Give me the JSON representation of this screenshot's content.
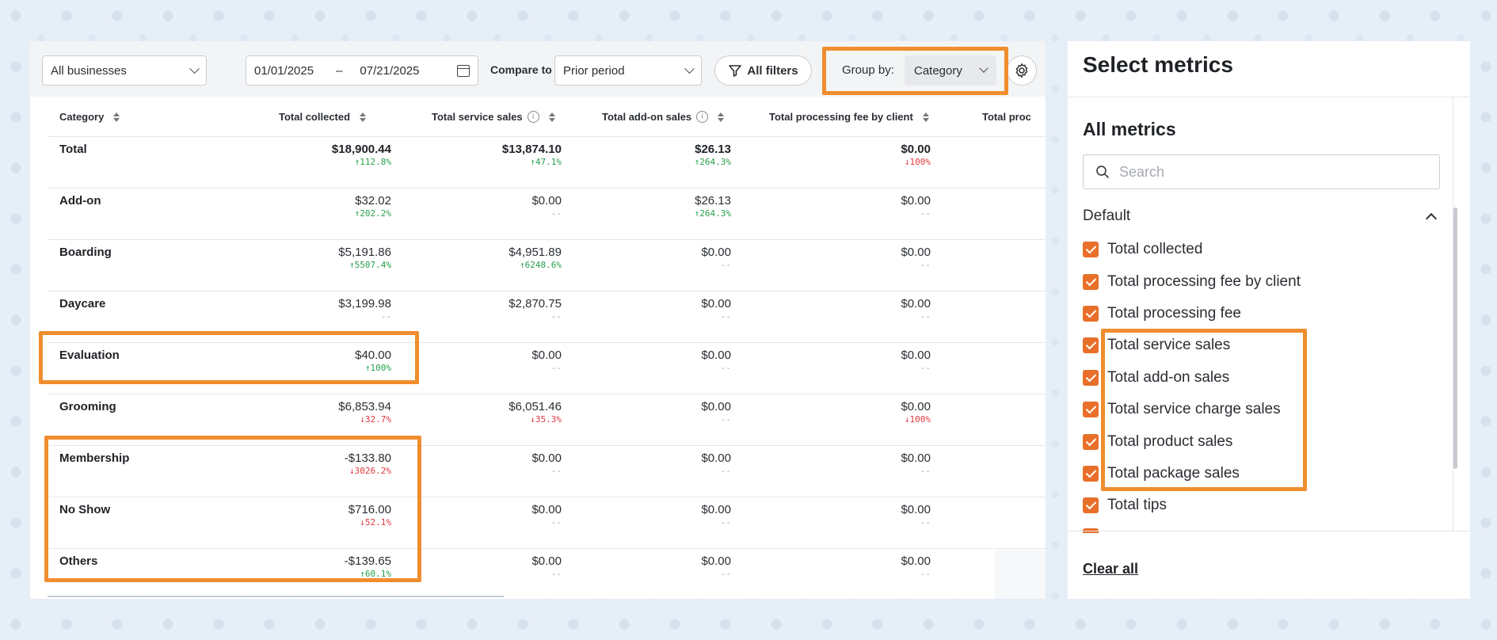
{
  "toolbar": {
    "business_select": "All businesses",
    "date_from": "01/01/2025",
    "date_sep": "–",
    "date_to": "07/21/2025",
    "compare_label": "Compare to",
    "compare_select": "Prior period",
    "filters_label": "All filters",
    "groupby_label": "Group by:",
    "groupby_value": "Category"
  },
  "table": {
    "headers": [
      "Category",
      "Total collected",
      "Total service sales",
      "Total add-on sales",
      "Total processing fee by client",
      "Total proc"
    ],
    "rows": [
      {
        "name": "Total",
        "bold": true,
        "cells": [
          {
            "val": "$18,900.44",
            "chg": "↑112.8%",
            "dir": "up"
          },
          {
            "val": "$13,874.10",
            "chg": "↑47.1%",
            "dir": "up"
          },
          {
            "val": "$26.13",
            "chg": "↑264.3%",
            "dir": "up"
          },
          {
            "val": "$0.00",
            "chg": "↓100%",
            "dir": "down"
          }
        ]
      },
      {
        "name": "Add-on",
        "cells": [
          {
            "val": "$32.02",
            "chg": "↑202.2%",
            "dir": "up"
          },
          {
            "val": "$0.00",
            "chg": "--",
            "dir": "none"
          },
          {
            "val": "$26.13",
            "chg": "↑264.3%",
            "dir": "up"
          },
          {
            "val": "$0.00",
            "chg": "--",
            "dir": "none"
          }
        ]
      },
      {
        "name": "Boarding",
        "cells": [
          {
            "val": "$5,191.86",
            "chg": "↑5507.4%",
            "dir": "up"
          },
          {
            "val": "$4,951.89",
            "chg": "↑6248.6%",
            "dir": "up"
          },
          {
            "val": "$0.00",
            "chg": "--",
            "dir": "none"
          },
          {
            "val": "$0.00",
            "chg": "--",
            "dir": "none"
          }
        ]
      },
      {
        "name": "Daycare",
        "cells": [
          {
            "val": "$3,199.98",
            "chg": "--",
            "dir": "none"
          },
          {
            "val": "$2,870.75",
            "chg": "--",
            "dir": "none"
          },
          {
            "val": "$0.00",
            "chg": "--",
            "dir": "none"
          },
          {
            "val": "$0.00",
            "chg": "--",
            "dir": "none"
          }
        ]
      },
      {
        "name": "Evaluation",
        "cells": [
          {
            "val": "$40.00",
            "chg": "↑100%",
            "dir": "up"
          },
          {
            "val": "$0.00",
            "chg": "--",
            "dir": "none"
          },
          {
            "val": "$0.00",
            "chg": "--",
            "dir": "none"
          },
          {
            "val": "$0.00",
            "chg": "--",
            "dir": "none"
          }
        ]
      },
      {
        "name": "Grooming",
        "cells": [
          {
            "val": "$6,853.94",
            "chg": "↓32.7%",
            "dir": "down"
          },
          {
            "val": "$6,051.46",
            "chg": "↓35.3%",
            "dir": "down"
          },
          {
            "val": "$0.00",
            "chg": "--",
            "dir": "none"
          },
          {
            "val": "$0.00",
            "chg": "↓100%",
            "dir": "down"
          }
        ]
      },
      {
        "name": "Membership",
        "cells": [
          {
            "val": "-$133.80",
            "chg": "↓3026.2%",
            "dir": "down"
          },
          {
            "val": "$0.00",
            "chg": "--",
            "dir": "none"
          },
          {
            "val": "$0.00",
            "chg": "--",
            "dir": "none"
          },
          {
            "val": "$0.00",
            "chg": "--",
            "dir": "none"
          }
        ]
      },
      {
        "name": "No Show",
        "cells": [
          {
            "val": "$716.00",
            "chg": "↓52.1%",
            "dir": "down"
          },
          {
            "val": "$0.00",
            "chg": "--",
            "dir": "none"
          },
          {
            "val": "$0.00",
            "chg": "--",
            "dir": "none"
          },
          {
            "val": "$0.00",
            "chg": "--",
            "dir": "none"
          }
        ]
      },
      {
        "name": "Others",
        "cells": [
          {
            "val": "-$139.65",
            "chg": "↑60.1%",
            "dir": "up"
          },
          {
            "val": "$0.00",
            "chg": "--",
            "dir": "none"
          },
          {
            "val": "$0.00",
            "chg": "--",
            "dir": "none"
          },
          {
            "val": "$0.00",
            "chg": "--",
            "dir": "none"
          }
        ]
      }
    ]
  },
  "metrics_panel": {
    "title": "Select metrics",
    "section_title": "All metrics",
    "search_placeholder": "Search",
    "group_label": "Default",
    "items": [
      "Total collected",
      "Total processing fee by client",
      "Total processing fee",
      "Total service sales",
      "Total add-on sales",
      "Total service charge sales",
      "Total product sales",
      "Total package sales",
      "Total tips"
    ],
    "clear_all": "Clear all"
  },
  "colors": {
    "highlight": "#f08d2e",
    "checkbox": "#e8702a",
    "positive": "#27a04a",
    "negative": "#e0393e"
  }
}
